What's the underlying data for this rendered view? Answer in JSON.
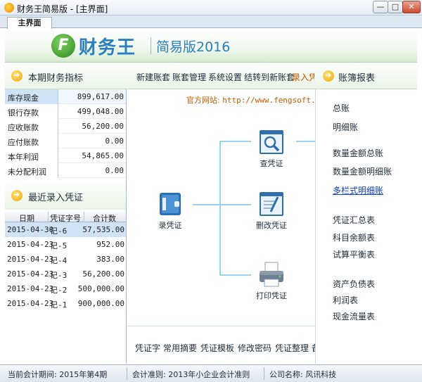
{
  "window": {
    "title": "财务王简易版 - [主界面]",
    "min_label": "—",
    "max_label": "□",
    "close_label": "✕"
  },
  "tabs": [
    {
      "label": "主界面"
    }
  ],
  "banner": {
    "logo_letter": "F",
    "brand": "财务王",
    "edition": "简易版2016"
  },
  "finance": {
    "title": "本期财务指标",
    "rows": [
      {
        "label": "库存现金",
        "value": "899,617.00"
      },
      {
        "label": "银行存款",
        "value": "499,048.00"
      },
      {
        "label": "应收账款",
        "value": "56,200.00"
      },
      {
        "label": "应付账款",
        "value": "0.00"
      },
      {
        "label": "本年利润",
        "value": "54,865.00"
      },
      {
        "label": "未分配利润",
        "value": "0.00"
      }
    ]
  },
  "recent": {
    "title": "最近录入凭证",
    "columns": [
      "日期",
      "凭证字号",
      "合计数"
    ],
    "rows": [
      {
        "date": "2015-04-30",
        "no": "记-6",
        "amount": "57,535.00"
      },
      {
        "date": "2015-04-23",
        "no": "记-5",
        "amount": "952.00"
      },
      {
        "date": "2015-04-23",
        "no": "记-4",
        "amount": "383.00"
      },
      {
        "date": "2015-04-23",
        "no": "记-3",
        "amount": "56,200.00"
      },
      {
        "date": "2015-04-23",
        "no": "记-2",
        "amount": "500,000.00"
      },
      {
        "date": "2015-04-23",
        "no": "记-1",
        "amount": "900,000.00"
      }
    ]
  },
  "toolbar": {
    "items": [
      "新建账套",
      "账套管理",
      "系统设置",
      "结转到新账套",
      "录入凭"
    ]
  },
  "center": {
    "website_label": "官方网站:",
    "website_url": "http://www.fengsoft.cn/",
    "ops": {
      "record": "录凭证",
      "view": "查凭证",
      "edit": "删改凭证",
      "print": "打印凭证"
    },
    "bottom_items": [
      "凭证字",
      "常用摘要",
      "凭证模板",
      "修改密码",
      "凭证整理",
      "备"
    ]
  },
  "reports": {
    "title": "账簿报表",
    "items": [
      {
        "label": "总账"
      },
      {
        "label": "明细账"
      },
      {
        "label": "数量金额总账"
      },
      {
        "label": "数量金额明细账"
      },
      {
        "label": "多栏式明细账"
      },
      {
        "label": "凭证汇总表"
      },
      {
        "label": "科目余额表"
      },
      {
        "label": "试算平衡表"
      },
      {
        "label": "资产负债表"
      },
      {
        "label": "利润表"
      },
      {
        "label": "现金流量表"
      }
    ]
  },
  "status": {
    "period": "当前会计期间: 2015年第4期",
    "standard": "会计准则: 2013年小企业会计准则",
    "company": "公司名称: 风讯科技"
  }
}
